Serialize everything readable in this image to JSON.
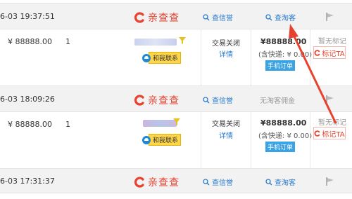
{
  "brand": {
    "name": "亲查查",
    "color": "#e8412e"
  },
  "links": {
    "check_credit": "查信誉",
    "check_taoke": "查淘客",
    "no_commission": "无淘客佣金"
  },
  "orders": [
    {
      "datetime": "6-03 19:37:51",
      "price": "¥ 88888.00",
      "qty": "1",
      "status": "交易关闭",
      "detail": "详情",
      "total": "¥88888.00",
      "ship": "(含快递: ¥ 0.00)",
      "badge": "手机订单",
      "contact": "和我联系",
      "no_mark": "暂无标记",
      "mark": "标记TA"
    },
    {
      "datetime": "6-03 18:09:26",
      "price": "¥ 88888.00",
      "qty": "1",
      "status": "交易关闭",
      "detail": "详情",
      "total": "¥88888.00",
      "ship": "(含快递: ¥ 0.00)",
      "badge": "手机订单",
      "contact": "和我联系",
      "no_mark": "暂无标记",
      "mark": "标记TA"
    },
    {
      "datetime": "6-03 17:31:37"
    }
  ],
  "colors": {
    "accent_red": "#e8412e",
    "link_blue": "#2a7ccc",
    "badge_blue": "#3aa3e3",
    "contact_yellow": "#ffd54a"
  }
}
